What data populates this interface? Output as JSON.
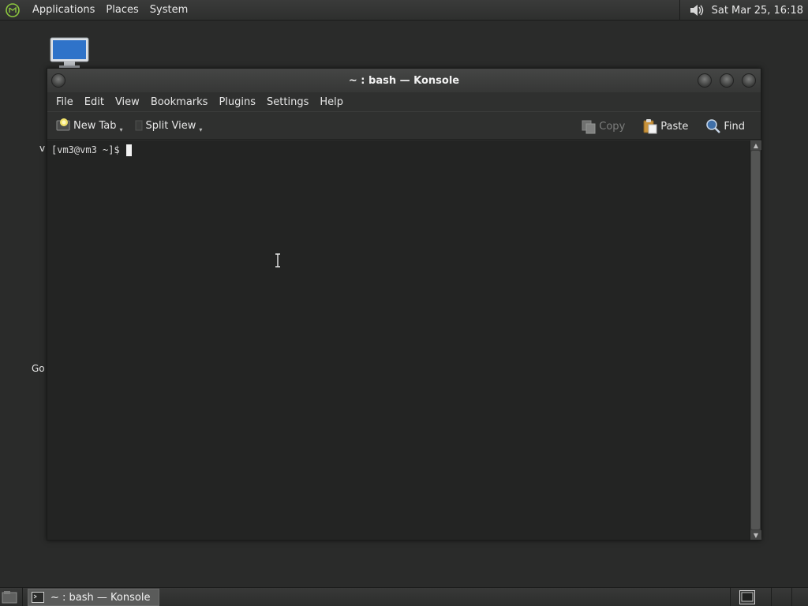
{
  "top_panel": {
    "menus": [
      "Applications",
      "Places",
      "System"
    ],
    "clock": "Sat Mar 25, 16:18",
    "icons": {
      "menu": "mint-menu-icon",
      "volume": "volume-icon"
    }
  },
  "desktop": {
    "labels": {
      "vm3": "v",
      "go": "Go"
    }
  },
  "window": {
    "title": "~ : bash — Konsole",
    "menu": [
      "File",
      "Edit",
      "View",
      "Bookmarks",
      "Plugins",
      "Settings",
      "Help"
    ],
    "toolbar": {
      "new_tab": "New Tab",
      "split_view": "Split View",
      "copy": "Copy",
      "paste": "Paste",
      "find": "Find"
    },
    "terminal": {
      "prompt": "[vm3@vm3 ~]$"
    }
  },
  "taskbar": {
    "task_label": "~ : bash — Konsole"
  },
  "colors": {
    "desktop_bg": "#2a2b2a",
    "terminal_bg": "#232423",
    "panel_bg": "#333433"
  }
}
